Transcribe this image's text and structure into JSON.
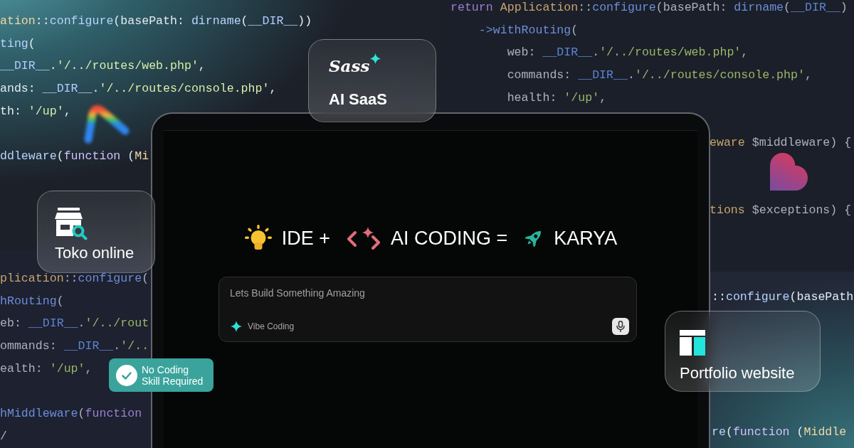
{
  "background_code": {
    "top_left": {
      "lines": [
        {
          "kind": "code",
          "tokens": [
            {
              "kind": "class",
              "text": "ation"
            },
            {
              "kind": "plain",
              "text": "::"
            },
            {
              "kind": "method",
              "text": "configure"
            },
            {
              "kind": "plain",
              "text": "(basePath: "
            },
            {
              "kind": "method",
              "text": "dirname"
            },
            {
              "kind": "plain",
              "text": "("
            },
            {
              "kind": "constant",
              "text": "__DIR__"
            },
            {
              "kind": "plain",
              "text": "))"
            }
          ]
        },
        {
          "kind": "code",
          "tokens": [
            {
              "kind": "method",
              "text": "ting"
            },
            {
              "kind": "plain",
              "text": "("
            }
          ]
        },
        {
          "kind": "code",
          "tokens": [
            {
              "kind": "constant",
              "text": "__DIR__"
            },
            {
              "kind": "plain",
              "text": "."
            },
            {
              "kind": "string",
              "text": "'/../routes/web.php'"
            },
            {
              "kind": "plain",
              "text": ","
            }
          ]
        },
        {
          "kind": "code",
          "tokens": [
            {
              "kind": "plain",
              "text": "ands: "
            },
            {
              "kind": "constant",
              "text": "__DIR__"
            },
            {
              "kind": "plain",
              "text": "."
            },
            {
              "kind": "string",
              "text": "'/../routes/console.php'"
            },
            {
              "kind": "plain",
              "text": ","
            }
          ]
        },
        {
          "kind": "code",
          "tokens": [
            {
              "kind": "plain",
              "text": "th: "
            },
            {
              "kind": "string",
              "text": "'/up'"
            },
            {
              "kind": "plain",
              "text": ","
            }
          ]
        },
        {
          "kind": "blank"
        },
        {
          "kind": "code",
          "tokens": [
            {
              "kind": "method",
              "text": "ddleware"
            },
            {
              "kind": "plain",
              "text": "("
            },
            {
              "kind": "keyword",
              "text": "function"
            },
            {
              "kind": "plain",
              "text": " ("
            },
            {
              "kind": "class",
              "text": "Mi"
            }
          ]
        }
      ]
    },
    "top_right": {
      "lines": [
        {
          "kind": "code",
          "tokens": [
            {
              "kind": "keyword",
              "text": "return "
            },
            {
              "kind": "class",
              "text": "Application"
            },
            {
              "kind": "plain",
              "text": "::"
            },
            {
              "kind": "method",
              "text": "configure"
            },
            {
              "kind": "plain",
              "text": "(basePath: "
            },
            {
              "kind": "method",
              "text": "dirname"
            },
            {
              "kind": "plain",
              "text": "("
            },
            {
              "kind": "constant",
              "text": "__DIR__"
            },
            {
              "kind": "plain",
              "text": ")"
            }
          ]
        },
        {
          "kind": "code",
          "tokens": [
            {
              "kind": "method",
              "text": "    ->withRouting"
            },
            {
              "kind": "plain",
              "text": "("
            }
          ]
        },
        {
          "kind": "code",
          "tokens": [
            {
              "kind": "plain",
              "text": "        web: "
            },
            {
              "kind": "constant",
              "text": "__DIR__"
            },
            {
              "kind": "plain",
              "text": "."
            },
            {
              "kind": "string",
              "text": "'/../routes/web.php'"
            },
            {
              "kind": "plain",
              "text": ","
            }
          ]
        },
        {
          "kind": "code",
          "tokens": [
            {
              "kind": "plain",
              "text": "        commands: "
            },
            {
              "kind": "constant",
              "text": "__DIR__"
            },
            {
              "kind": "plain",
              "text": "."
            },
            {
              "kind": "string",
              "text": "'/../routes/console.php'"
            },
            {
              "kind": "plain",
              "text": ","
            }
          ]
        },
        {
          "kind": "code",
          "tokens": [
            {
              "kind": "plain",
              "text": "        health: "
            },
            {
              "kind": "string",
              "text": "'/up'"
            },
            {
              "kind": "plain",
              "text": ","
            }
          ]
        },
        {
          "kind": "blank"
        },
        {
          "kind": "fragment",
          "tokens": [
            {
              "kind": "class",
              "text": "eware"
            },
            {
              "kind": "plain",
              "text": " $middleware) {"
            }
          ]
        },
        {
          "kind": "blank"
        },
        {
          "kind": "blank"
        },
        {
          "kind": "fragment",
          "tokens": [
            {
              "kind": "class",
              "text": "tions"
            },
            {
              "kind": "plain",
              "text": " $exceptions) {"
            }
          ]
        }
      ]
    },
    "bottom_left": {
      "lines": [
        {
          "kind": "code",
          "tokens": [
            {
              "kind": "class",
              "text": "plication"
            },
            {
              "kind": "plain",
              "text": "::"
            },
            {
              "kind": "method",
              "text": "configure"
            },
            {
              "kind": "plain",
              "text": "("
            }
          ]
        },
        {
          "kind": "code",
          "tokens": [
            {
              "kind": "method",
              "text": "hRouting"
            },
            {
              "kind": "plain",
              "text": "("
            }
          ]
        },
        {
          "kind": "code",
          "tokens": [
            {
              "kind": "plain",
              "text": "eb: "
            },
            {
              "kind": "constant",
              "text": "__DIR__"
            },
            {
              "kind": "plain",
              "text": "."
            },
            {
              "kind": "string",
              "text": "'/../rout"
            }
          ]
        },
        {
          "kind": "code",
          "tokens": [
            {
              "kind": "plain",
              "text": "ommands: "
            },
            {
              "kind": "constant",
              "text": "__DIR__"
            },
            {
              "kind": "plain",
              "text": "."
            },
            {
              "kind": "string",
              "text": "'/.."
            }
          ]
        },
        {
          "kind": "code",
          "tokens": [
            {
              "kind": "plain",
              "text": "ealth: "
            },
            {
              "kind": "string",
              "text": "'/up'"
            },
            {
              "kind": "plain",
              "text": ","
            }
          ]
        },
        {
          "kind": "blank"
        },
        {
          "kind": "code",
          "tokens": [
            {
              "kind": "method",
              "text": "hMiddleware"
            },
            {
              "kind": "plain",
              "text": "("
            },
            {
              "kind": "keyword",
              "text": "function"
            }
          ]
        },
        {
          "kind": "code",
          "tokens": [
            {
              "kind": "plain",
              "text": "/"
            }
          ]
        }
      ]
    },
    "bottom_right": {
      "lines": [
        {
          "kind": "code",
          "tokens": [
            {
              "kind": "plain",
              "text": "::"
            },
            {
              "kind": "method",
              "text": "configure"
            },
            {
              "kind": "plain",
              "text": "(basePath"
            }
          ]
        },
        {
          "kind": "blank"
        },
        {
          "kind": "blank"
        },
        {
          "kind": "blank"
        },
        {
          "kind": "blank"
        },
        {
          "kind": "blank"
        },
        {
          "kind": "code",
          "tokens": [
            {
              "kind": "method",
              "text": "re"
            },
            {
              "kind": "plain",
              "text": "("
            },
            {
              "kind": "keyword",
              "text": "function"
            },
            {
              "kind": "plain",
              "text": " ("
            },
            {
              "kind": "class",
              "text": "Middle"
            }
          ]
        }
      ]
    }
  },
  "cards": [
    {
      "kind": "saas",
      "logo_text": "Sass",
      "title": "AI SaaS"
    },
    {
      "kind": "store",
      "title": "Toko online"
    },
    {
      "kind": "portfolio",
      "title": "Portfolio website"
    }
  ],
  "headline": [
    {
      "kind": "bulb",
      "text": "IDE +"
    },
    {
      "kind": "code",
      "text": "AI CODING ="
    },
    {
      "kind": "rocket",
      "text": "KARYA"
    }
  ],
  "prompt": {
    "placeholder": "Lets Build Something Amazing",
    "mode_label": "Vibe Coding"
  },
  "badge": {
    "text": "No Coding Skill Required"
  }
}
